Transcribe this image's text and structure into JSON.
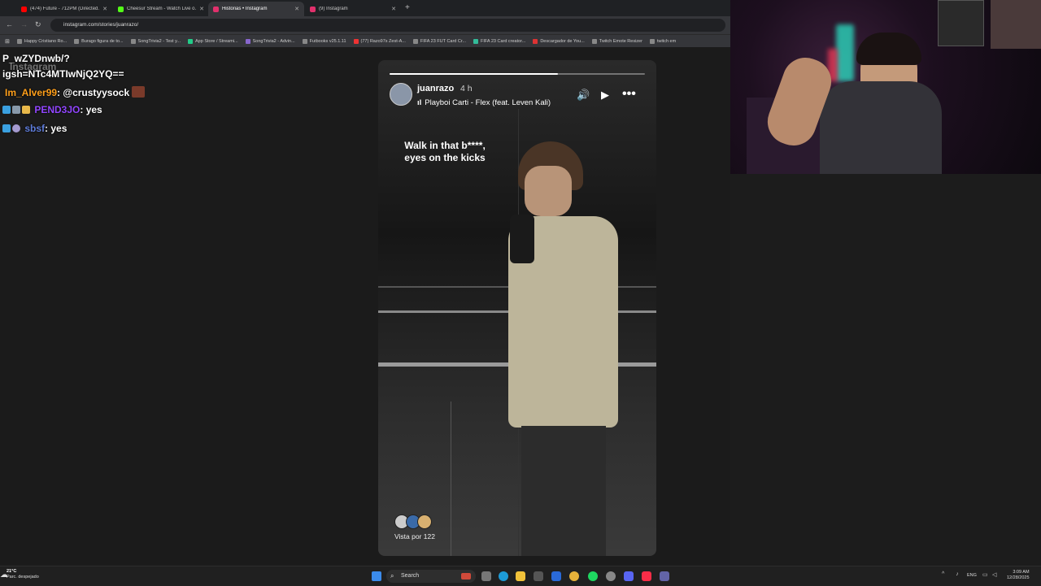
{
  "browser": {
    "tabs": [
      {
        "label": "(474) Future - 712PM (Directed...",
        "active": false,
        "fav_color": "#ff0000"
      },
      {
        "label": "Cheesur Stream - Watch Live o...",
        "active": false,
        "fav_color": "#53fc18"
      },
      {
        "label": "Historias • Instagram",
        "active": true,
        "fav_color": "#e1306c"
      },
      {
        "label": "(9) Instagram",
        "active": false,
        "fav_color": "#e1306c"
      }
    ],
    "url": "instagram.com/stories/juanrazo/",
    "bookmarks": [
      "Happy Cristiano Ro...",
      "Burago figura de to...",
      "SongTrivia2 - Test y...",
      "App Store / Streami...",
      "SongTrivia2 - Advin...",
      "Futbooks v25.1.11",
      "(77) Razo97s Zest-A...",
      "FIFA 23 FUT Card Cr...",
      "FIFA 23 Card creator...",
      "Descargador de You...",
      "Twitch Emote Resizer",
      "twitch em"
    ]
  },
  "chat": {
    "fragments": [
      "P_wZYDnwb/?",
      "igsh=NTc4MTIwNjQ2YQ==",
      "Instagram"
    ],
    "messages": [
      {
        "user": "Im_Alver99",
        "text": ": @crustyysock",
        "color": "#ff9f1a"
      },
      {
        "user": "PEND3JO",
        "text": ": yes",
        "color": "#9146ff"
      },
      {
        "user": "sbsf",
        "text": ": yes",
        "color": "#5d7bd8"
      }
    ]
  },
  "story": {
    "username": "juanrazo",
    "time_ago": "4 h",
    "song": "Playboi Carti - Flex (feat. Leven Kali)",
    "caption": "Walk in that b****, eyes on the kicks",
    "seen_by": "Vista por 122",
    "progress": 0.66
  },
  "taskbar": {
    "weather_temp": "21°C",
    "weather_desc": "Parc. despejado",
    "search_placeholder": "Search",
    "language": "ENG",
    "time": "3:09 AM",
    "date": "12/28/2025"
  }
}
